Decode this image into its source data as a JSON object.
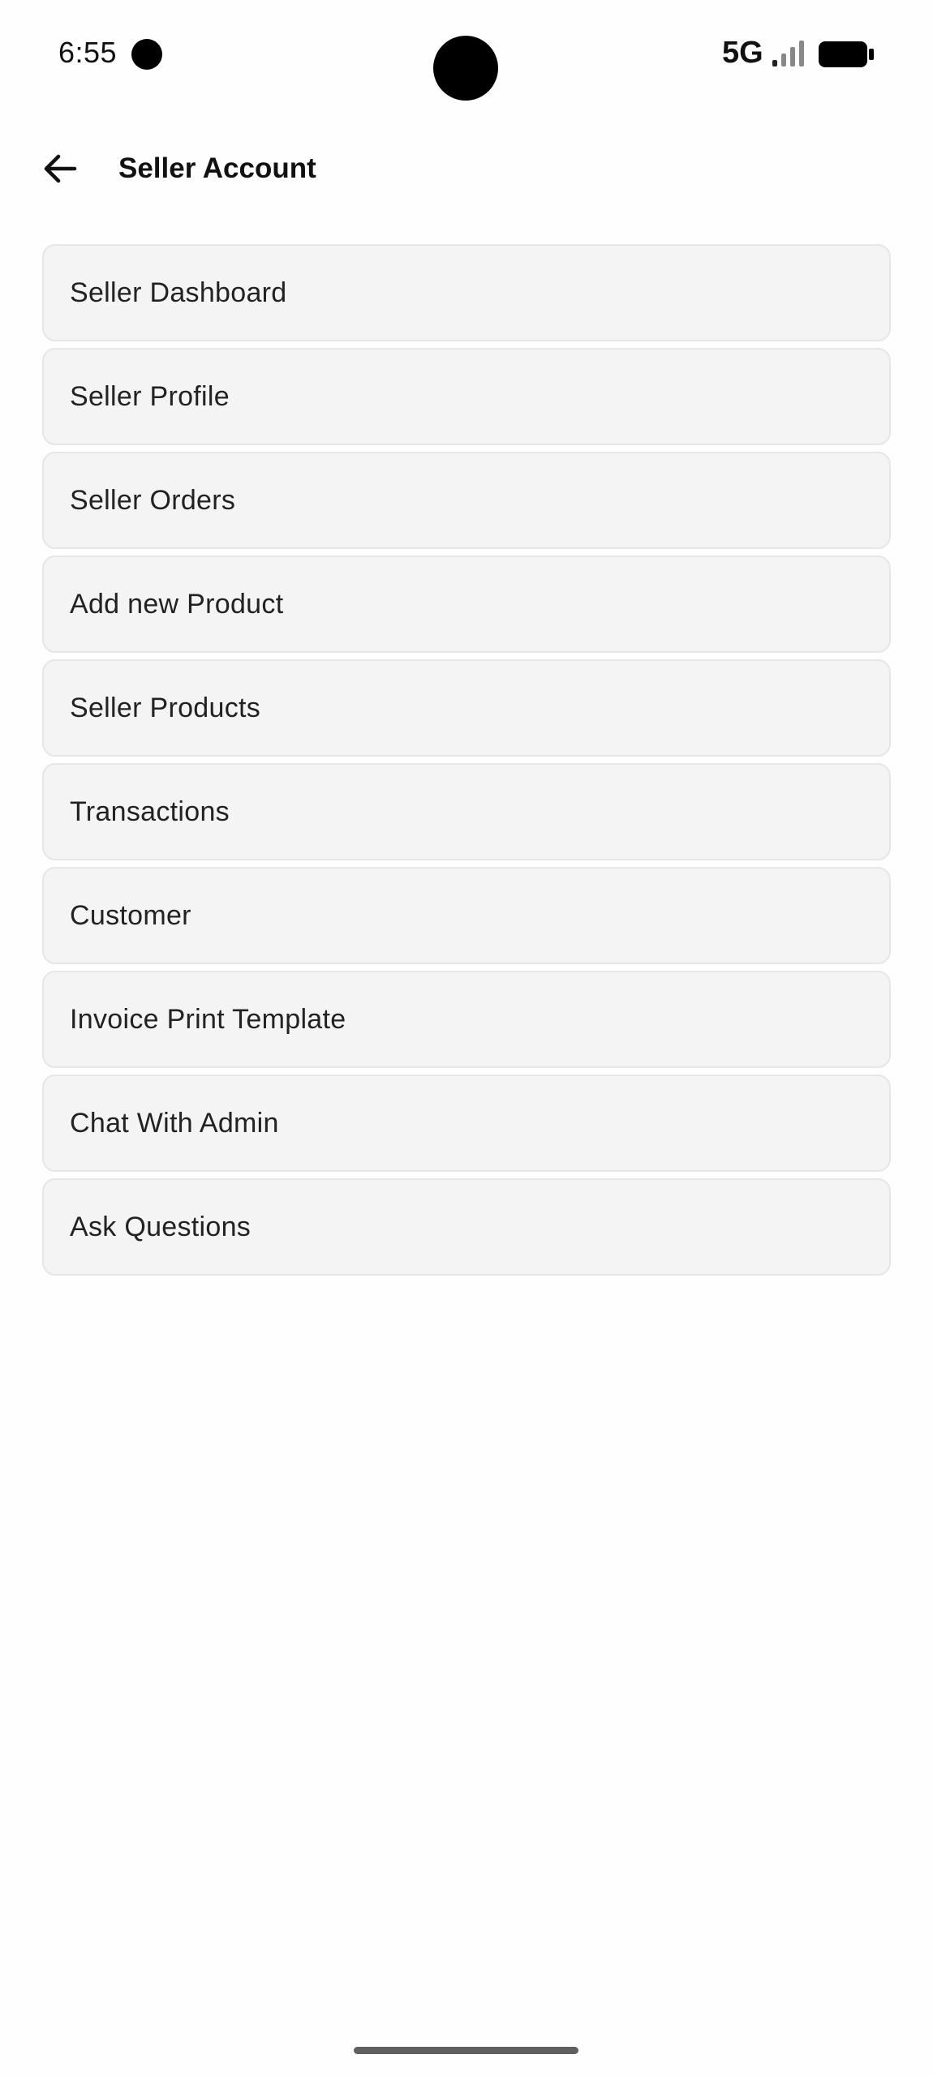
{
  "status_bar": {
    "time": "6:55",
    "network": "5G"
  },
  "app_bar": {
    "title": "Seller Account"
  },
  "menu": {
    "items": [
      {
        "label": "Seller Dashboard"
      },
      {
        "label": "Seller Profile"
      },
      {
        "label": "Seller Orders"
      },
      {
        "label": "Add new Product"
      },
      {
        "label": "Seller Products"
      },
      {
        "label": "Transactions"
      },
      {
        "label": "Customer"
      },
      {
        "label": "Invoice Print Template"
      },
      {
        "label": "Chat With Admin"
      },
      {
        "label": "Ask Questions"
      }
    ]
  },
  "icons": {
    "back": "arrow-left-icon",
    "signal": "signal-strength-icon",
    "battery": "battery-icon",
    "notification": "notification-dot-icon"
  },
  "colors": {
    "background": "#fefefe",
    "item_background": "#f4f4f4",
    "item_border": "#e6e6e6",
    "text": "#222222"
  }
}
